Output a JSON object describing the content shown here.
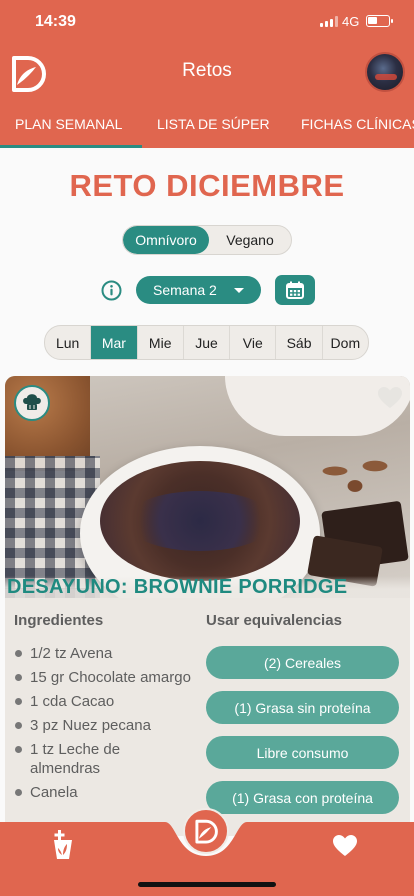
{
  "status_bar": {
    "time": "14:39",
    "network": "4G",
    "battery_level": 0.45
  },
  "header": {
    "title": "Retos"
  },
  "tabs": [
    {
      "label": "PLAN SEMANAL",
      "active": true
    },
    {
      "label": "LISTA DE SÚPER",
      "active": false
    },
    {
      "label": "FICHAS CLÍNICAS",
      "active": false
    }
  ],
  "challenge": {
    "title": "RETO DICIEMBRE"
  },
  "diet_toggle": {
    "options": [
      "Omnívoro",
      "Vegano"
    ],
    "selected": "Omnívoro"
  },
  "week_selector": {
    "value": "Semana 2"
  },
  "days": {
    "items": [
      "Lun",
      "Mar",
      "Mie",
      "Jue",
      "Vie",
      "Sáb",
      "Dom"
    ],
    "selected": "Mar"
  },
  "meal": {
    "title": "DESAYUNO: BROWNIE PORRIDGE",
    "ingredients_heading": "Ingredientes",
    "equivalences_heading": "Usar equivalencias",
    "ingredients": [
      "1/2 tz Avena",
      "15  gr Chocolate amargo",
      "1  cda Cacao",
      "3  pz Nuez pecana",
      "1  tz Leche de almendras",
      "Canela"
    ],
    "equivalences": [
      "(2) Cereales",
      "(1) Grasa sin proteína",
      "Libre consumo",
      "(1) Grasa con proteína"
    ]
  },
  "colors": {
    "brand": "#e0664f",
    "accent": "#2a8c82",
    "equivalence": "#5aa89a"
  },
  "icons": [
    "logo-icon",
    "info-icon",
    "calendar-icon",
    "chef-hat-icon",
    "heart-outline-icon",
    "add-food-icon",
    "heart-icon"
  ]
}
